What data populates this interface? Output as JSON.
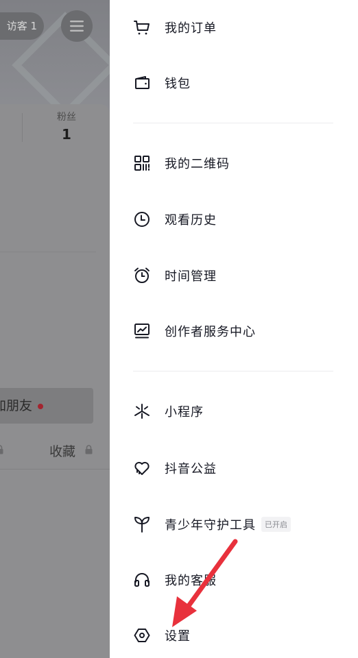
{
  "background_profile": {
    "visitor_label": "访客 1",
    "fans_label": "粉丝",
    "fans_count": "1",
    "add_friend_label": "加朋友",
    "collect_tab_label": "收藏"
  },
  "drawer": {
    "groups": [
      [
        {
          "label": "我的订单",
          "icon": "cart-icon"
        },
        {
          "label": "钱包",
          "icon": "wallet-icon"
        }
      ],
      [
        {
          "label": "我的二维码",
          "icon": "qr-code-icon"
        },
        {
          "label": "观看历史",
          "icon": "clock-icon"
        },
        {
          "label": "时间管理",
          "icon": "alarm-clock-icon"
        },
        {
          "label": "创作者服务中心",
          "icon": "creator-chart-icon"
        }
      ],
      [
        {
          "label": "小程序",
          "icon": "mini-program-icon"
        },
        {
          "label": "抖音公益",
          "icon": "charity-heart-icon"
        },
        {
          "label": "青少年守护工具",
          "icon": "sprout-icon",
          "badge": "已开启"
        },
        {
          "label": "我的客服",
          "icon": "headset-icon"
        },
        {
          "label": "设置",
          "icon": "settings-hexagon-icon"
        }
      ]
    ]
  },
  "colors": {
    "annotation_arrow": "#e8313c",
    "text": "#161823"
  }
}
